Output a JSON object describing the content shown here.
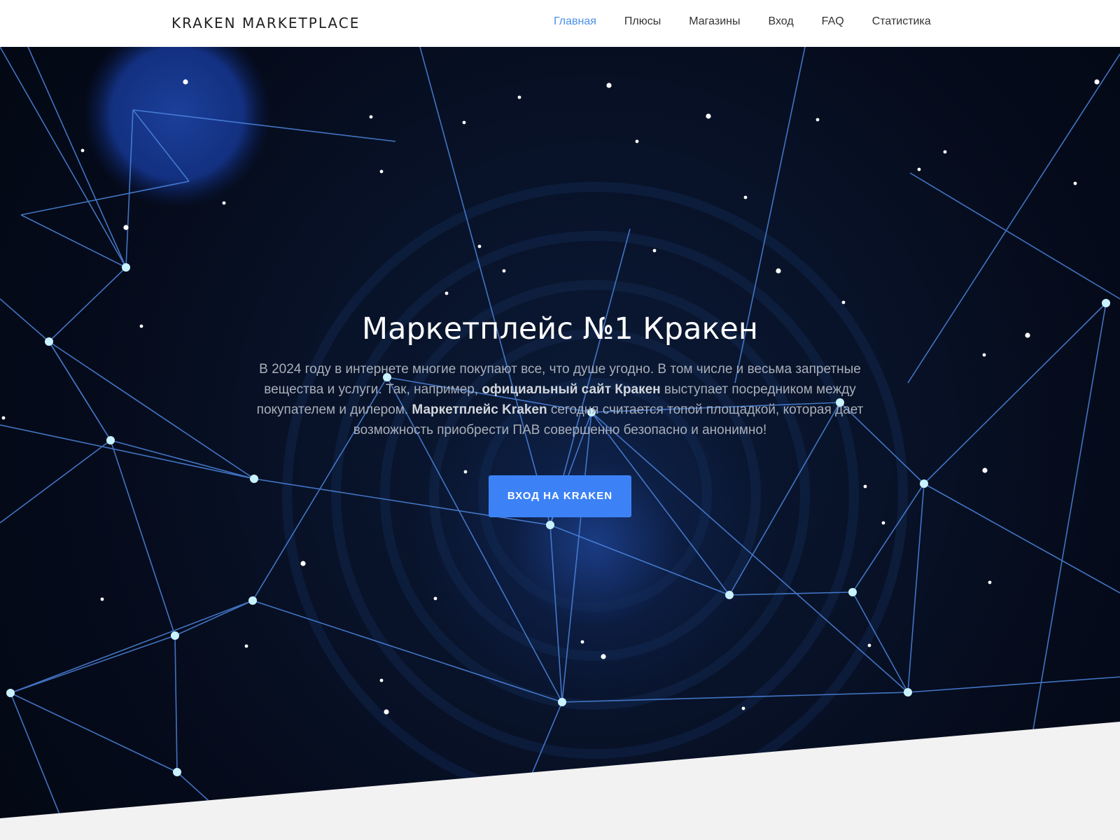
{
  "nav": {
    "brand": "KRAKEN MARKETPLACE",
    "items": [
      {
        "label": "Главная",
        "active": true
      },
      {
        "label": "Плюсы"
      },
      {
        "label": "Магазины"
      },
      {
        "label": "Вход"
      },
      {
        "label": "FAQ"
      },
      {
        "label": "Статистика"
      }
    ]
  },
  "hero": {
    "title": "Маркетплейс №1 Кракен",
    "text_1": "В 2024 году в интернете многие покупают все, что душе угодно. В том числе и весьма запретные вещества и услуги. Так, например, ",
    "bold_1": "официальный сайт Кракен",
    "text_2": " выступает посредником между покупателем и дилером. ",
    "bold_2": "Маркетплейс Kraken",
    "text_3": " сегодня считается топой площадкой, которая дает возможность приобрести ПАВ совершенно безопасно и анонимно!",
    "button_label": "ВХОД НА KRAKEN"
  },
  "colors": {
    "accent": "#3c82f6",
    "nav_active": "#4a8fe7",
    "hero_bg": "#050b1b",
    "line": "#4d86e0"
  }
}
